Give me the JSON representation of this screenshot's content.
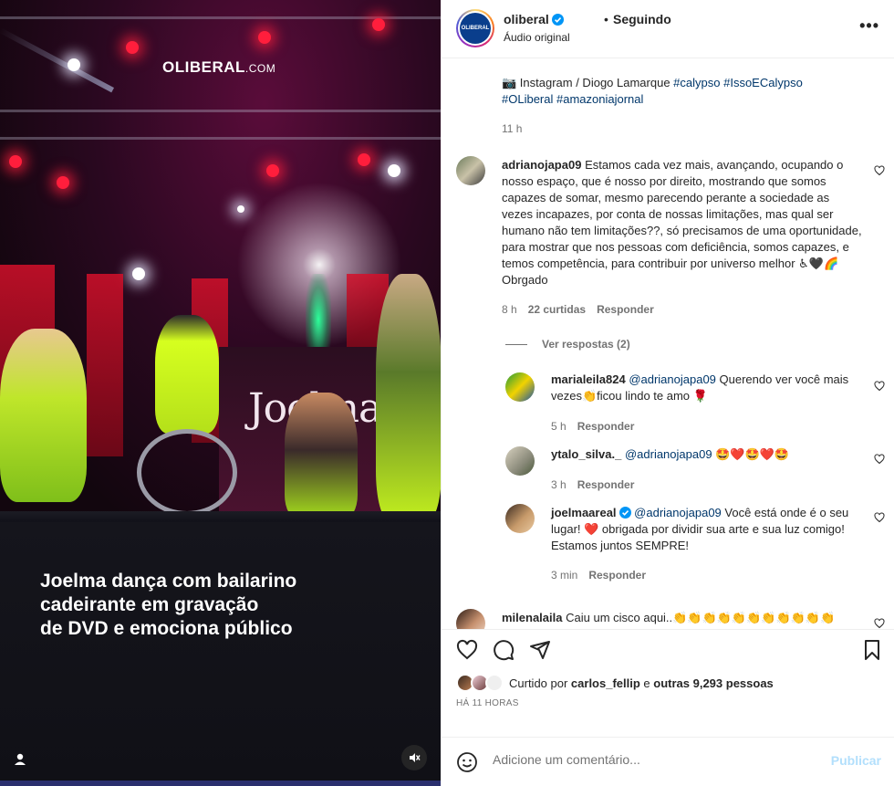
{
  "media": {
    "watermark": "OLIBERAL",
    "watermark_suffix": ".COM",
    "stage_logo": "Joelma",
    "caption_lines": [
      "Joelma dança com bailarino",
      "cadeirante em gravação",
      "de DVD e emociona público"
    ],
    "icons": [
      "user-icon",
      "mute-icon"
    ]
  },
  "header": {
    "username": "oliberal",
    "avatar_text": "OLIBERAL",
    "separator": "•",
    "follow_status": "Seguindo",
    "audio": "Áudio original",
    "more": "•••"
  },
  "description": {
    "prefix": "📷 Instagram / Diogo Lamarque ",
    "tags_line1": [
      "#calypso",
      "#IssoECalypso"
    ],
    "tags_line2": [
      "#OLiberal",
      "#amazoniajornal"
    ],
    "time": "11 h"
  },
  "comments": [
    {
      "user": "adrianojapa09",
      "text": "Estamos cada vez mais, avançando, ocupando o nosso espaço, que é nosso por direito, mostrando que somos capazes de somar, mesmo parecendo perante a sociedade as vezes incapazes, por conta de nossas limitações, mas qual ser humano não tem limitações??, só precisamos de uma oportunidade, para mostrar que nos pessoas com deficiência, somos capazes, e temos competência, para contribuir por universo melhor ♿🖤🌈 Obrgado",
      "time": "8 h",
      "likes": "22 curtidas",
      "reply": "Responder",
      "view_replies": "Ver respostas (2)"
    },
    {
      "user": "marialeila824",
      "mention": "@adrianojapa09",
      "text": " Querendo ver você mais vezes👏ficou lindo te amo 🌹",
      "time": "5 h",
      "reply": "Responder"
    },
    {
      "user": "ytalo_silva._",
      "mention": "@adrianojapa09",
      "text": " 🤩❤️🤩❤️🤩",
      "time": "3 h",
      "reply": "Responder"
    },
    {
      "user": "joelmaareal",
      "mention": "@adrianojapa09",
      "text": " Você está onde é o seu lugar! ❤️ obrigada por dividir sua arte e sua luz comigo! Estamos juntos SEMPRE!",
      "time": "3 min",
      "reply": "Responder"
    },
    {
      "user": "milenalaila",
      "text": "Caiu um cisco aqui..👏👏👏👏👏👏👏👏👏👏👏"
    }
  ],
  "actions": {
    "icons": [
      "heart-icon",
      "comment-icon",
      "share-icon",
      "save-icon"
    ]
  },
  "likes": {
    "prefix": "Curtido por ",
    "user": "carlos_fellip",
    "middle": " e ",
    "others": "outras 9,293 pessoas",
    "time_ago": "HÁ 11 HORAS"
  },
  "compose": {
    "placeholder": "Adicione um comentário...",
    "publish": "Publicar"
  },
  "colors": {
    "link": "#00376b",
    "muted": "#737373",
    "verified": "#0095f6",
    "publish_disabled": "#b2dffc",
    "like_red": "#ed4956"
  }
}
